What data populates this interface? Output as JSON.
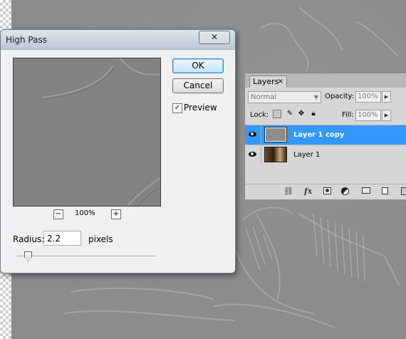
{
  "dialog": {
    "title": "High Pass",
    "close_label": "✕",
    "ok_label": "OK",
    "cancel_label": "Cancel",
    "preview_label": "Preview",
    "preview_checked": true,
    "zoom_out_label": "−",
    "zoom_in_label": "+",
    "zoom_level": "100%",
    "radius_label": "Radius:",
    "radius_value": "2.2",
    "radius_unit": "pixels",
    "radius_slider_fraction": 0.08
  },
  "layers_panel": {
    "tab_label": "Layers",
    "tab_close": "×",
    "blend_mode": "Normal",
    "opacity_label": "Opacity:",
    "opacity_value": "100%",
    "lock_label": "Lock:",
    "fill_label": "Fill:",
    "fill_value": "100%",
    "layers": [
      {
        "name": "Layer 1 copy",
        "selected": true,
        "visible": true
      },
      {
        "name": "Layer 1",
        "selected": false,
        "visible": true
      }
    ],
    "footer_icons": [
      "link-icon",
      "fx-icon",
      "mask-icon",
      "adjustment-icon",
      "group-icon",
      "new-layer-icon",
      "trash-icon"
    ],
    "fx_label": "fx"
  },
  "colors": {
    "selection": "#3399ff",
    "canvas_gray": "#8b8b8b"
  }
}
